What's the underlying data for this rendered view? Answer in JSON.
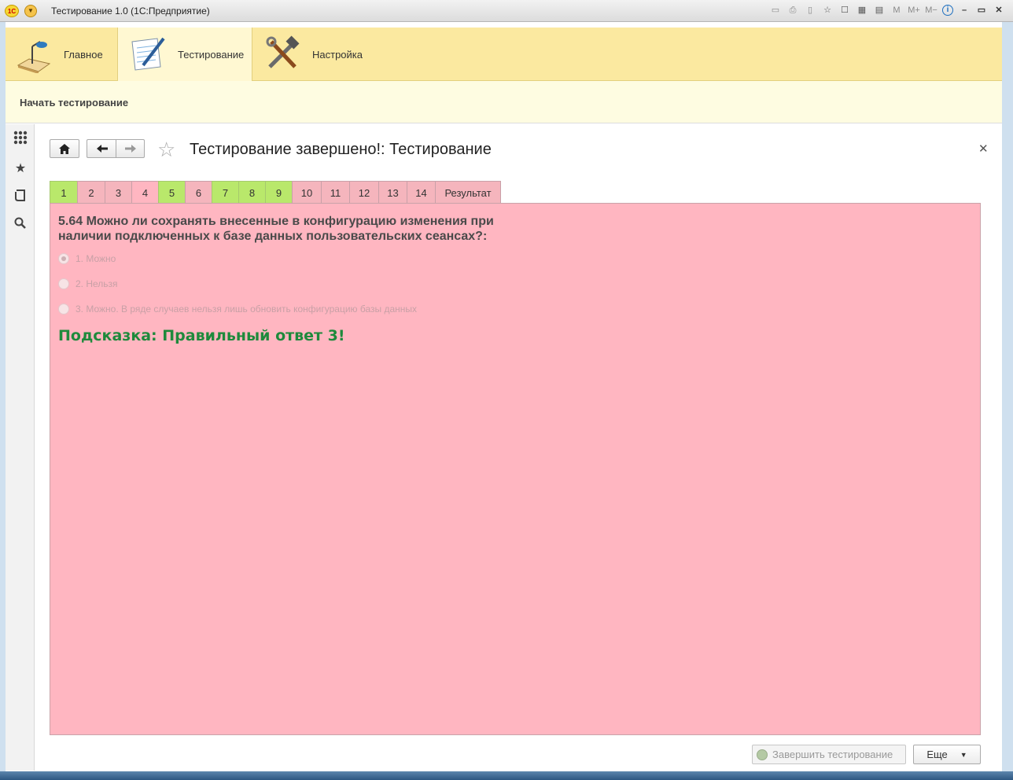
{
  "window": {
    "title": "Тестирование 1.0  (1С:Предприятие)",
    "logo_text": "1С"
  },
  "sections": [
    {
      "label": "Главное",
      "icon": "desk-lamp-icon"
    },
    {
      "label": "Тестирование",
      "icon": "notepad-pen-icon",
      "active": true
    },
    {
      "label": "Настройка",
      "icon": "tools-icon"
    }
  ],
  "actions": {
    "start_label": "Начать тестирование"
  },
  "form": {
    "title": "Тестирование завершено!: Тестирование",
    "tabs": [
      {
        "label": "1",
        "state": "green"
      },
      {
        "label": "2",
        "state": "pink"
      },
      {
        "label": "3",
        "state": "pink"
      },
      {
        "label": "4",
        "state": "active"
      },
      {
        "label": "5",
        "state": "green"
      },
      {
        "label": "6",
        "state": "pink"
      },
      {
        "label": "7",
        "state": "green"
      },
      {
        "label": "8",
        "state": "green"
      },
      {
        "label": "9",
        "state": "green"
      },
      {
        "label": "10",
        "state": "pink"
      },
      {
        "label": "11",
        "state": "pink"
      },
      {
        "label": "12",
        "state": "pink"
      },
      {
        "label": "13",
        "state": "pink"
      },
      {
        "label": "14",
        "state": "pink"
      },
      {
        "label": "Результат",
        "state": "pink"
      }
    ],
    "question": "5.64 Можно ли сохранять внесенные в конфигурацию изменения при наличии подключенных к базе данных пользовательских сеансах?:",
    "options": [
      {
        "label": "1. Можно",
        "selected": true
      },
      {
        "label": "2. Нельзя",
        "selected": false
      },
      {
        "label": "3. Можно. В ряде случаев нельзя лишь обновить конфигурацию базы данных",
        "selected": false
      }
    ],
    "hint": "Подсказка: Правильный ответ 3!",
    "finish_button": "Завершить тестирование",
    "more_button": "Еще"
  },
  "colors": {
    "green_tab": "#b9e86b",
    "pink_tab": "#f5b5bd",
    "panel": "#ffb6c1",
    "hint": "#1e8a3c",
    "sections_bg": "#fbe9a0"
  }
}
